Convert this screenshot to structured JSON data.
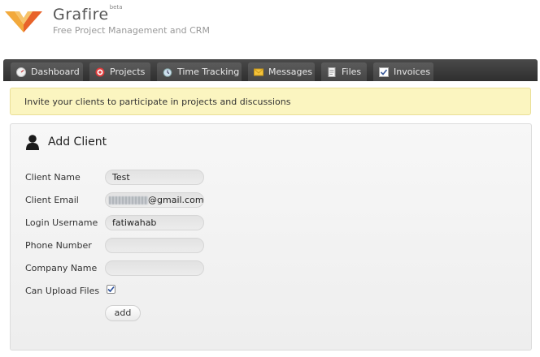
{
  "brand": {
    "name": "Grafire",
    "badge": "beta",
    "tagline": "Free Project Management and CRM"
  },
  "nav": {
    "tabs": [
      {
        "label": "Dashboard",
        "icon": "dashboard-gauge-icon"
      },
      {
        "label": "Projects",
        "icon": "target-icon"
      },
      {
        "label": "Time Tracking",
        "icon": "alarm-clock-icon"
      },
      {
        "label": "Messages",
        "icon": "envelope-icon"
      },
      {
        "label": "Files",
        "icon": "document-icon"
      },
      {
        "label": "Invoices",
        "icon": "checked-box-icon"
      }
    ]
  },
  "notice": {
    "text": "Invite your clients to participate in projects and discussions"
  },
  "form": {
    "title": "Add Client",
    "fields": {
      "client_name": {
        "label": "Client Name",
        "value": "Test"
      },
      "client_email": {
        "label": "Client Email",
        "value": "@gmail.com"
      },
      "login_username": {
        "label": "Login Username",
        "value": "fatiwahab"
      },
      "phone_number": {
        "label": "Phone Number",
        "value": ""
      },
      "company_name": {
        "label": "Company Name",
        "value": ""
      }
    },
    "can_upload_files": {
      "label": "Can Upload Files",
      "checked": true
    },
    "submit_label": "add"
  },
  "colors": {
    "navbar": "#3a3a3a",
    "notice_bg": "#fbf5c0",
    "logo_orange": "#e8632a",
    "logo_gold": "#f2a93b"
  }
}
